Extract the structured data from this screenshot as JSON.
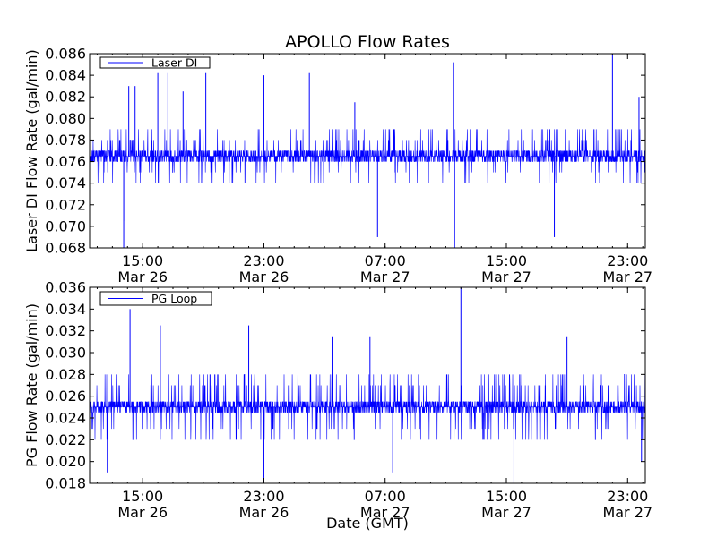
{
  "title": "APOLLO Flow Rates",
  "xlabel": "Date (GMT)",
  "line_color": "#0000ff",
  "chart_data": [
    {
      "type": "line",
      "series": [
        {
          "name": "Laser DI"
        }
      ],
      "ylabel": "Laser DI Flow Rate (gal/min)",
      "ylim": [
        0.068,
        0.086
      ],
      "yticks": [
        "0.068",
        "0.070",
        "0.072",
        "0.074",
        "0.076",
        "0.078",
        "0.080",
        "0.082",
        "0.084",
        "0.086"
      ],
      "xticks": [
        {
          "time": "15:00",
          "date": "Mar 26"
        },
        {
          "time": "23:00",
          "date": "Mar 26"
        },
        {
          "time": "07:00",
          "date": "Mar 27"
        },
        {
          "time": "15:00",
          "date": "Mar 27"
        },
        {
          "time": "23:00",
          "date": "Mar 27"
        }
      ],
      "xlim": [
        "2013-03-26 11:30",
        "2013-03-28 00:10"
      ],
      "baseline": 0.0765,
      "typical_band": [
        0.075,
        0.078
      ],
      "spikes": [
        {
          "x": "2013-03-26 13:45",
          "y": 0.068
        },
        {
          "x": "2013-03-26 13:50",
          "y": 0.0705
        },
        {
          "x": "2013-03-26 14:05",
          "y": 0.083
        },
        {
          "x": "2013-03-26 14:30",
          "y": 0.083
        },
        {
          "x": "2013-03-26 16:00",
          "y": 0.0842
        },
        {
          "x": "2013-03-26 16:40",
          "y": 0.0842
        },
        {
          "x": "2013-03-26 17:40",
          "y": 0.0825
        },
        {
          "x": "2013-03-26 19:10",
          "y": 0.0842
        },
        {
          "x": "2013-03-26 23:00",
          "y": 0.084
        },
        {
          "x": "2013-03-27 02:00",
          "y": 0.0842
        },
        {
          "x": "2013-03-27 05:00",
          "y": 0.0815
        },
        {
          "x": "2013-03-27 06:30",
          "y": 0.069
        },
        {
          "x": "2013-03-27 11:30",
          "y": 0.0852
        },
        {
          "x": "2013-03-27 11:35",
          "y": 0.068
        },
        {
          "x": "2013-03-27 18:10",
          "y": 0.069
        },
        {
          "x": "2013-03-27 22:00",
          "y": 0.086
        },
        {
          "x": "2013-03-27 23:45",
          "y": 0.082
        }
      ]
    },
    {
      "type": "line",
      "series": [
        {
          "name": "PG Loop"
        }
      ],
      "ylabel": "PG Flow Rate (gal/min)",
      "ylim": [
        0.018,
        0.036
      ],
      "yticks": [
        "0.018",
        "0.020",
        "0.022",
        "0.024",
        "0.026",
        "0.028",
        "0.030",
        "0.032",
        "0.034",
        "0.036"
      ],
      "xticks": [
        {
          "time": "15:00",
          "date": "Mar 26"
        },
        {
          "time": "23:00",
          "date": "Mar 26"
        },
        {
          "time": "07:00",
          "date": "Mar 27"
        },
        {
          "time": "15:00",
          "date": "Mar 27"
        },
        {
          "time": "23:00",
          "date": "Mar 27"
        }
      ],
      "xlim": [
        "2013-03-26 11:30",
        "2013-03-28 00:10"
      ],
      "baseline": 0.025,
      "typical_band": [
        0.023,
        0.027
      ],
      "spikes": [
        {
          "x": "2013-03-26 12:40",
          "y": 0.019
        },
        {
          "x": "2013-03-26 14:10",
          "y": 0.034
        },
        {
          "x": "2013-03-26 16:10",
          "y": 0.0325
        },
        {
          "x": "2013-03-26 22:00",
          "y": 0.0325
        },
        {
          "x": "2013-03-26 23:00",
          "y": 0.018
        },
        {
          "x": "2013-03-27 03:30",
          "y": 0.0315
        },
        {
          "x": "2013-03-27 06:00",
          "y": 0.0315
        },
        {
          "x": "2013-03-27 07:30",
          "y": 0.019
        },
        {
          "x": "2013-03-27 12:00",
          "y": 0.036
        },
        {
          "x": "2013-03-27 15:30",
          "y": 0.018
        },
        {
          "x": "2013-03-27 19:00",
          "y": 0.0315
        },
        {
          "x": "2013-03-27 23:55",
          "y": 0.02
        }
      ]
    }
  ]
}
